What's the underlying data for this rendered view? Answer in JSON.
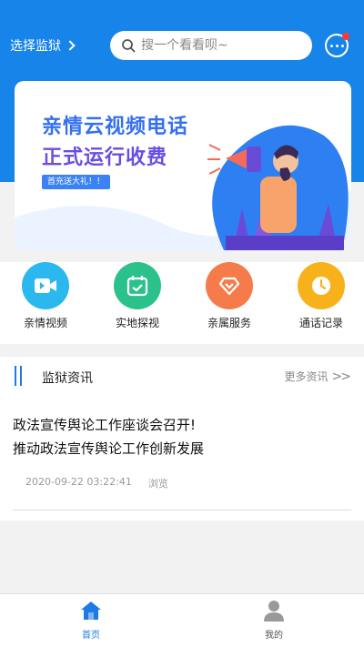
{
  "header": {
    "select_prison": "选择监狱",
    "search_placeholder": "搜一个看看呗~"
  },
  "banner": {
    "title_line1": "亲情云视频电话",
    "title_line2": "正式运行收费",
    "tag": "首充送大礼！！"
  },
  "quick_actions": [
    {
      "label": "亲情视频",
      "icon": "video-camera-icon",
      "color": "#2bb8ef"
    },
    {
      "label": "实地探视",
      "icon": "calendar-check-icon",
      "color": "#2ac28a"
    },
    {
      "label": "亲属服务",
      "icon": "heart-diamond-icon",
      "color": "#f57b4a"
    },
    {
      "label": "通话记录",
      "icon": "clock-icon",
      "color": "#f7b21b"
    }
  ],
  "news": {
    "section_title": "监狱资讯",
    "more_label": "更多资讯",
    "item": {
      "title_line1": "政法宣传舆论工作座谈会召开!",
      "title_line2": "推动政法宣传舆论工作创新发展",
      "date": "2020-09-22 03:22:41",
      "views_label": "浏览"
    }
  },
  "tabbar": {
    "home_label": "首页",
    "mine_label": "我的",
    "active_color": "#1e7be6",
    "inactive_color": "#888888"
  }
}
